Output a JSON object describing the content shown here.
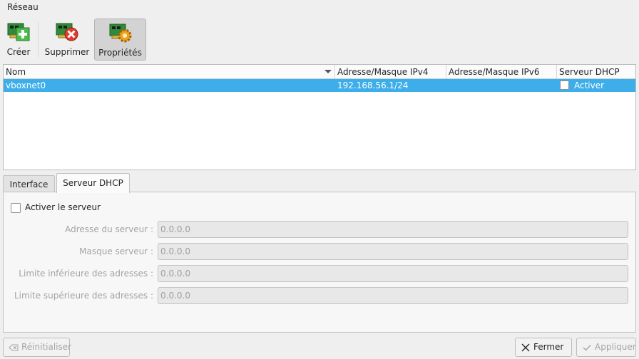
{
  "menubar": {
    "reseau_label": "Réseau"
  },
  "toolbar": {
    "create_label": "Créer",
    "delete_label": "Supprimer",
    "properties_label": "Propriétés",
    "create_icon": "network-card-add-icon",
    "delete_icon": "network-card-remove-icon",
    "properties_icon": "network-card-settings-icon"
  },
  "table": {
    "columns": [
      "Nom",
      "Adresse/Masque IPv4",
      "Adresse/Masque IPv6",
      "Serveur DHCP"
    ],
    "rows": [
      {
        "name": "vboxnet0",
        "ipv4": "192.168.56.1/24",
        "ipv6": "",
        "dhcp_label": "Activer",
        "dhcp_checked": false
      }
    ]
  },
  "tabs": {
    "interface_label": "Interface",
    "dhcp_label": "Serveur DHCP"
  },
  "dhcp": {
    "enable_label": "Activer le serveur",
    "enabled": false,
    "server_address_label": "Adresse du serveur :",
    "server_address_value": "0.0.0.0",
    "server_mask_label": "Masque serveur :",
    "server_mask_value": "0.0.0.0",
    "lower_limit_label": "Limite inférieure des adresses :",
    "lower_limit_value": "0.0.0.0",
    "upper_limit_label": "Limite supérieure des adresses :",
    "upper_limit_value": "0.0.0.0"
  },
  "buttons": {
    "reset_label": "Réinitialiser",
    "close_label": "Fermer",
    "apply_label": "Appliquer"
  },
  "colors": {
    "selection": "#3daee9",
    "window_bg": "#efefef",
    "add_green": "#3aa83a",
    "delete_red": "#e23d2a",
    "gear_orange": "#f0a020"
  }
}
